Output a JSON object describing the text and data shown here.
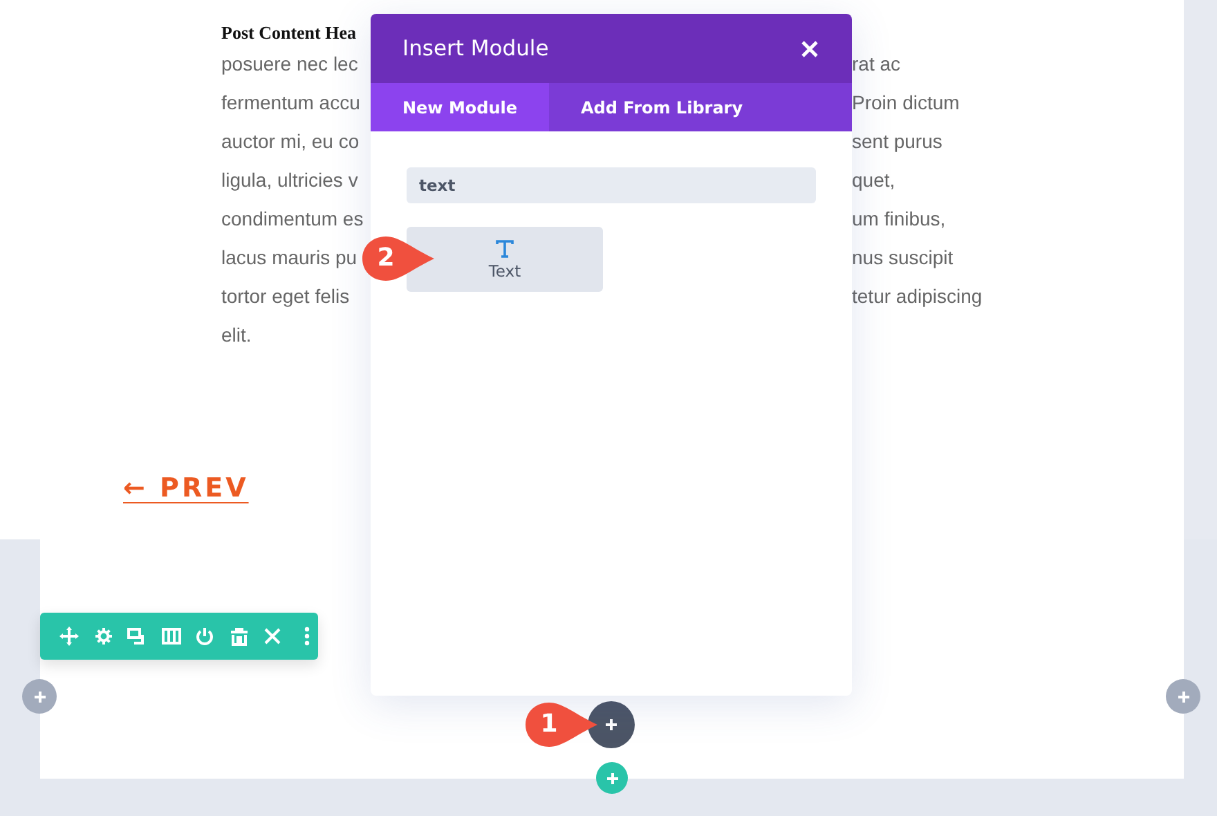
{
  "post": {
    "heading": "Post Content Hea",
    "lines": [
      {
        "left": "posuere nec lec",
        "right": "rat ac"
      },
      {
        "left": "fermentum accu",
        "right": "Proin dictum"
      },
      {
        "left": "auctor mi, eu co",
        "right": "sent purus"
      },
      {
        "left": "ligula, ultricies v",
        "right": "quet,"
      },
      {
        "left": "condimentum es",
        "right": "um finibus,"
      },
      {
        "left": "lacus mauris pu",
        "right": "nus suscipit"
      },
      {
        "left": "tortor eget felis",
        "right": "tetur adipiscing"
      },
      {
        "left": "elit."
      }
    ],
    "prev_link": "← PREV"
  },
  "modal": {
    "title": "Insert Module",
    "tabs": [
      {
        "label": "New Module",
        "selected": true
      },
      {
        "label": "Add From Library",
        "selected": false
      }
    ],
    "search": {
      "value": "text"
    },
    "modules": [
      {
        "label": "Text"
      }
    ]
  },
  "badges": [
    {
      "number": "2"
    },
    {
      "number": "1"
    }
  ]
}
